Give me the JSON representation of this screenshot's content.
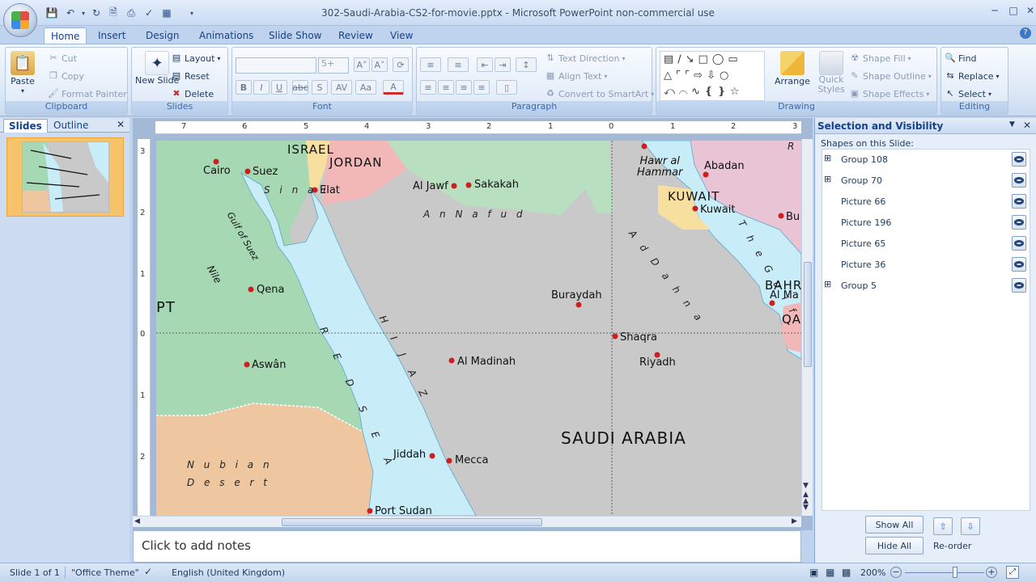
{
  "window": {
    "title": "302-Saudi-Arabia-CS2-for-movie.pptx - Microsoft PowerPoint non-commercial use"
  },
  "ribbon_tabs": [
    "Home",
    "Insert",
    "Design",
    "Animations",
    "Slide Show",
    "Review",
    "View"
  ],
  "clipboard": {
    "paste": "Paste",
    "cut": "Cut",
    "copy": "Copy",
    "format_painter": "Format Painter",
    "label": "Clipboard"
  },
  "slides_group": {
    "new_slide": "New Slide",
    "layout": "Layout",
    "reset": "Reset",
    "delete": "Delete",
    "label": "Slides"
  },
  "font_group": {
    "font_name": "",
    "font_size": "5+",
    "label": "Font"
  },
  "paragraph_group": {
    "text_direction": "Text Direction",
    "align_text": "Align Text",
    "convert_smartart": "Convert to SmartArt",
    "label": "Paragraph"
  },
  "drawing_group": {
    "arrange": "Arrange",
    "quick_styles": "Quick Styles",
    "shape_fill": "Shape Fill",
    "shape_outline": "Shape Outline",
    "shape_effects": "Shape Effects",
    "label": "Drawing"
  },
  "editing_group": {
    "find": "Find",
    "replace": "Replace",
    "select": "Select",
    "label": "Editing"
  },
  "left_pane": {
    "tab_slides": "Slides",
    "tab_outline": "Outline",
    "slide_number": "1"
  },
  "rulers": {
    "horizontal": [
      "7",
      "6",
      "5",
      "4",
      "3",
      "2",
      "1",
      "0",
      "1",
      "2",
      "3"
    ],
    "vertical": [
      "3",
      "2",
      "1",
      "0",
      "1",
      "2"
    ]
  },
  "map_labels": {
    "israel": "ISRAEL",
    "jordan": "JORDAN",
    "cairo": "Cairo",
    "suez": "Suez",
    "sinai": "S i n a i",
    "elat": "Elat",
    "gulf_of_suez": "Gulf of Suez",
    "al_jawf": "Al Jawf",
    "sakakah": "Sakakah",
    "an_nafud": "A n   N a f u d",
    "nile": "Nile",
    "qena": "Qena",
    "egypt": "PT",
    "buraydah": "Buraydah",
    "shaqra": "Shaqra",
    "hijaz": "H I J A Z",
    "red_sea": "R E D   S E A",
    "al_madinah": "Al Madinah",
    "riyadh": "Riyadh",
    "aswan": "Aswân",
    "saudi_arabia": "SAUDI ARABIA",
    "nubian_desert": "N u b i a n\nD e s e r t",
    "jiddah": "Jiddah",
    "mecca": "Mecca",
    "port_sudan": "Port Sudan",
    "hawr_al_hammar": "Hawr al\nHammar",
    "abadan": "Abadan",
    "kuwait_country": "KUWAIT",
    "kuwait_city": "Kuwait",
    "ad_dahna": "A d   D a h n a",
    "the_gulf": "T h e   G u l f",
    "bu": "Bu",
    "bahrain": "BAHR",
    "al_ma": "Al Ma",
    "qatar": "QA",
    "r_top": "R"
  },
  "notes": {
    "placeholder": "Click to add notes"
  },
  "selection_pane": {
    "title": "Selection and Visibility",
    "subtitle": "Shapes on this Slide:",
    "shapes": [
      {
        "name": "Group 108",
        "expandable": true
      },
      {
        "name": "Group 70",
        "expandable": true
      },
      {
        "name": "Picture 66",
        "expandable": false
      },
      {
        "name": "Picture 196",
        "expandable": false
      },
      {
        "name": "Picture 65",
        "expandable": false
      },
      {
        "name": "Picture 36",
        "expandable": false
      },
      {
        "name": "Group 5",
        "expandable": true
      }
    ],
    "show_all": "Show All",
    "hide_all": "Hide All",
    "reorder": "Re-order"
  },
  "status": {
    "slide": "Slide 1 of 1",
    "theme": "\"Office Theme\"",
    "language": "English (United Kingdom)",
    "zoom": "200%"
  },
  "colors": {
    "sea": "#c8ecf8",
    "saudi": "#c9c9c9",
    "egypt": "#a6d8b4",
    "israel": "#f7dfa0",
    "jordan": "#f2b8b8",
    "sudan": "#eec6a0",
    "kuwait": "#f7dfa0",
    "iran": "#e8c4d4",
    "iraq": "#b8dfc0",
    "city_dot": "#cc2020"
  }
}
